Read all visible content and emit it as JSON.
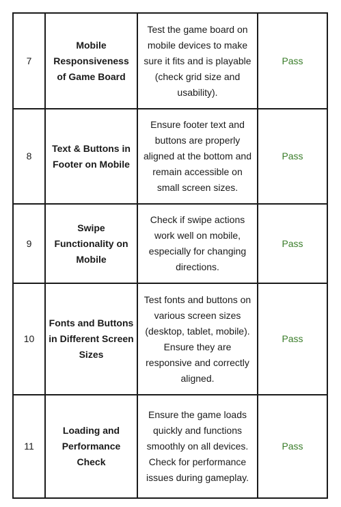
{
  "table": {
    "rows": [
      {
        "id": "7",
        "name": "Mobile Responsiveness of Game Board",
        "description": "Test the game board on mobile devices to make sure it fits and is playable (check grid size and usability).",
        "status": "Pass"
      },
      {
        "id": "8",
        "name": "Text & Buttons in Footer on Mobile",
        "description": "Ensure footer text and buttons are properly aligned at the bottom and remain accessible on small screen sizes.",
        "status": "Pass"
      },
      {
        "id": "9",
        "name": "Swipe Functionality on Mobile",
        "description": "Check if swipe actions work well on mobile, especially for changing directions.",
        "status": "Pass"
      },
      {
        "id": "10",
        "name": "Fonts and Buttons in Different Screen Sizes",
        "description": "Test fonts and buttons on various screen sizes (desktop, tablet, mobile). Ensure they are responsive and correctly aligned.",
        "status": "Pass"
      },
      {
        "id": "11",
        "name": "Loading and Performance Check",
        "description": "Ensure the game loads quickly and functions smoothly on all devices. Check for performance issues during gameplay.",
        "status": "Pass"
      }
    ],
    "colors": {
      "border": "#1a1a1a",
      "text": "#1a1a1a",
      "pass": "#3a7d2a"
    }
  }
}
